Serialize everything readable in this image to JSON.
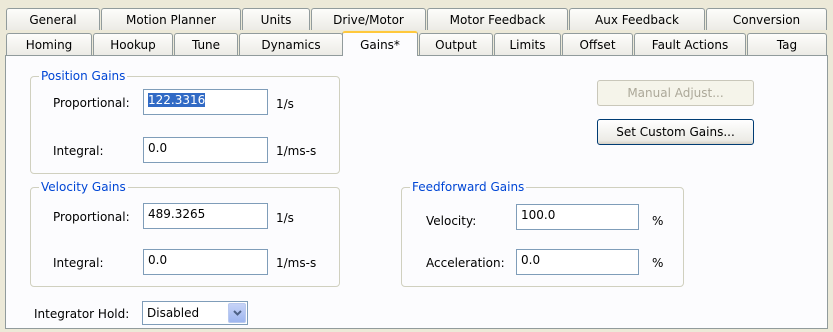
{
  "tabs_row1": [
    "General",
    "Motion Planner",
    "Units",
    "Drive/Motor",
    "Motor Feedback",
    "Aux Feedback",
    "Conversion"
  ],
  "tabs_row2": [
    "Homing",
    "Hookup",
    "Tune",
    "Dynamics",
    "Gains*",
    "Output",
    "Limits",
    "Offset",
    "Fault Actions",
    "Tag"
  ],
  "active_tab": "Gains*",
  "position_gains": {
    "title": "Position Gains",
    "proportional_label": "Proportional:",
    "proportional_value": "122.3316",
    "proportional_unit": "1/s",
    "integral_label": "Integral:",
    "integral_value": "0.0",
    "integral_unit": "1/ms-s"
  },
  "velocity_gains": {
    "title": "Velocity Gains",
    "proportional_label": "Proportional:",
    "proportional_value": "489.3265",
    "proportional_unit": "1/s",
    "integral_label": "Integral:",
    "integral_value": "0.0",
    "integral_unit": "1/ms-s"
  },
  "feedforward_gains": {
    "title": "Feedforward Gains",
    "velocity_label": "Velocity:",
    "velocity_value": "100.0",
    "velocity_unit": "%",
    "acceleration_label": "Acceleration:",
    "acceleration_value": "0.0",
    "acceleration_unit": "%"
  },
  "buttons": {
    "manual_adjust": "Manual Adjust...",
    "set_custom_gains": "Set Custom Gains..."
  },
  "integrator_hold": {
    "label": "Integrator Hold:",
    "value": "Disabled"
  },
  "colors": {
    "group_title": "#0046d5",
    "selection": "#316ac5",
    "active_tab_accent": "#ffc83c"
  }
}
